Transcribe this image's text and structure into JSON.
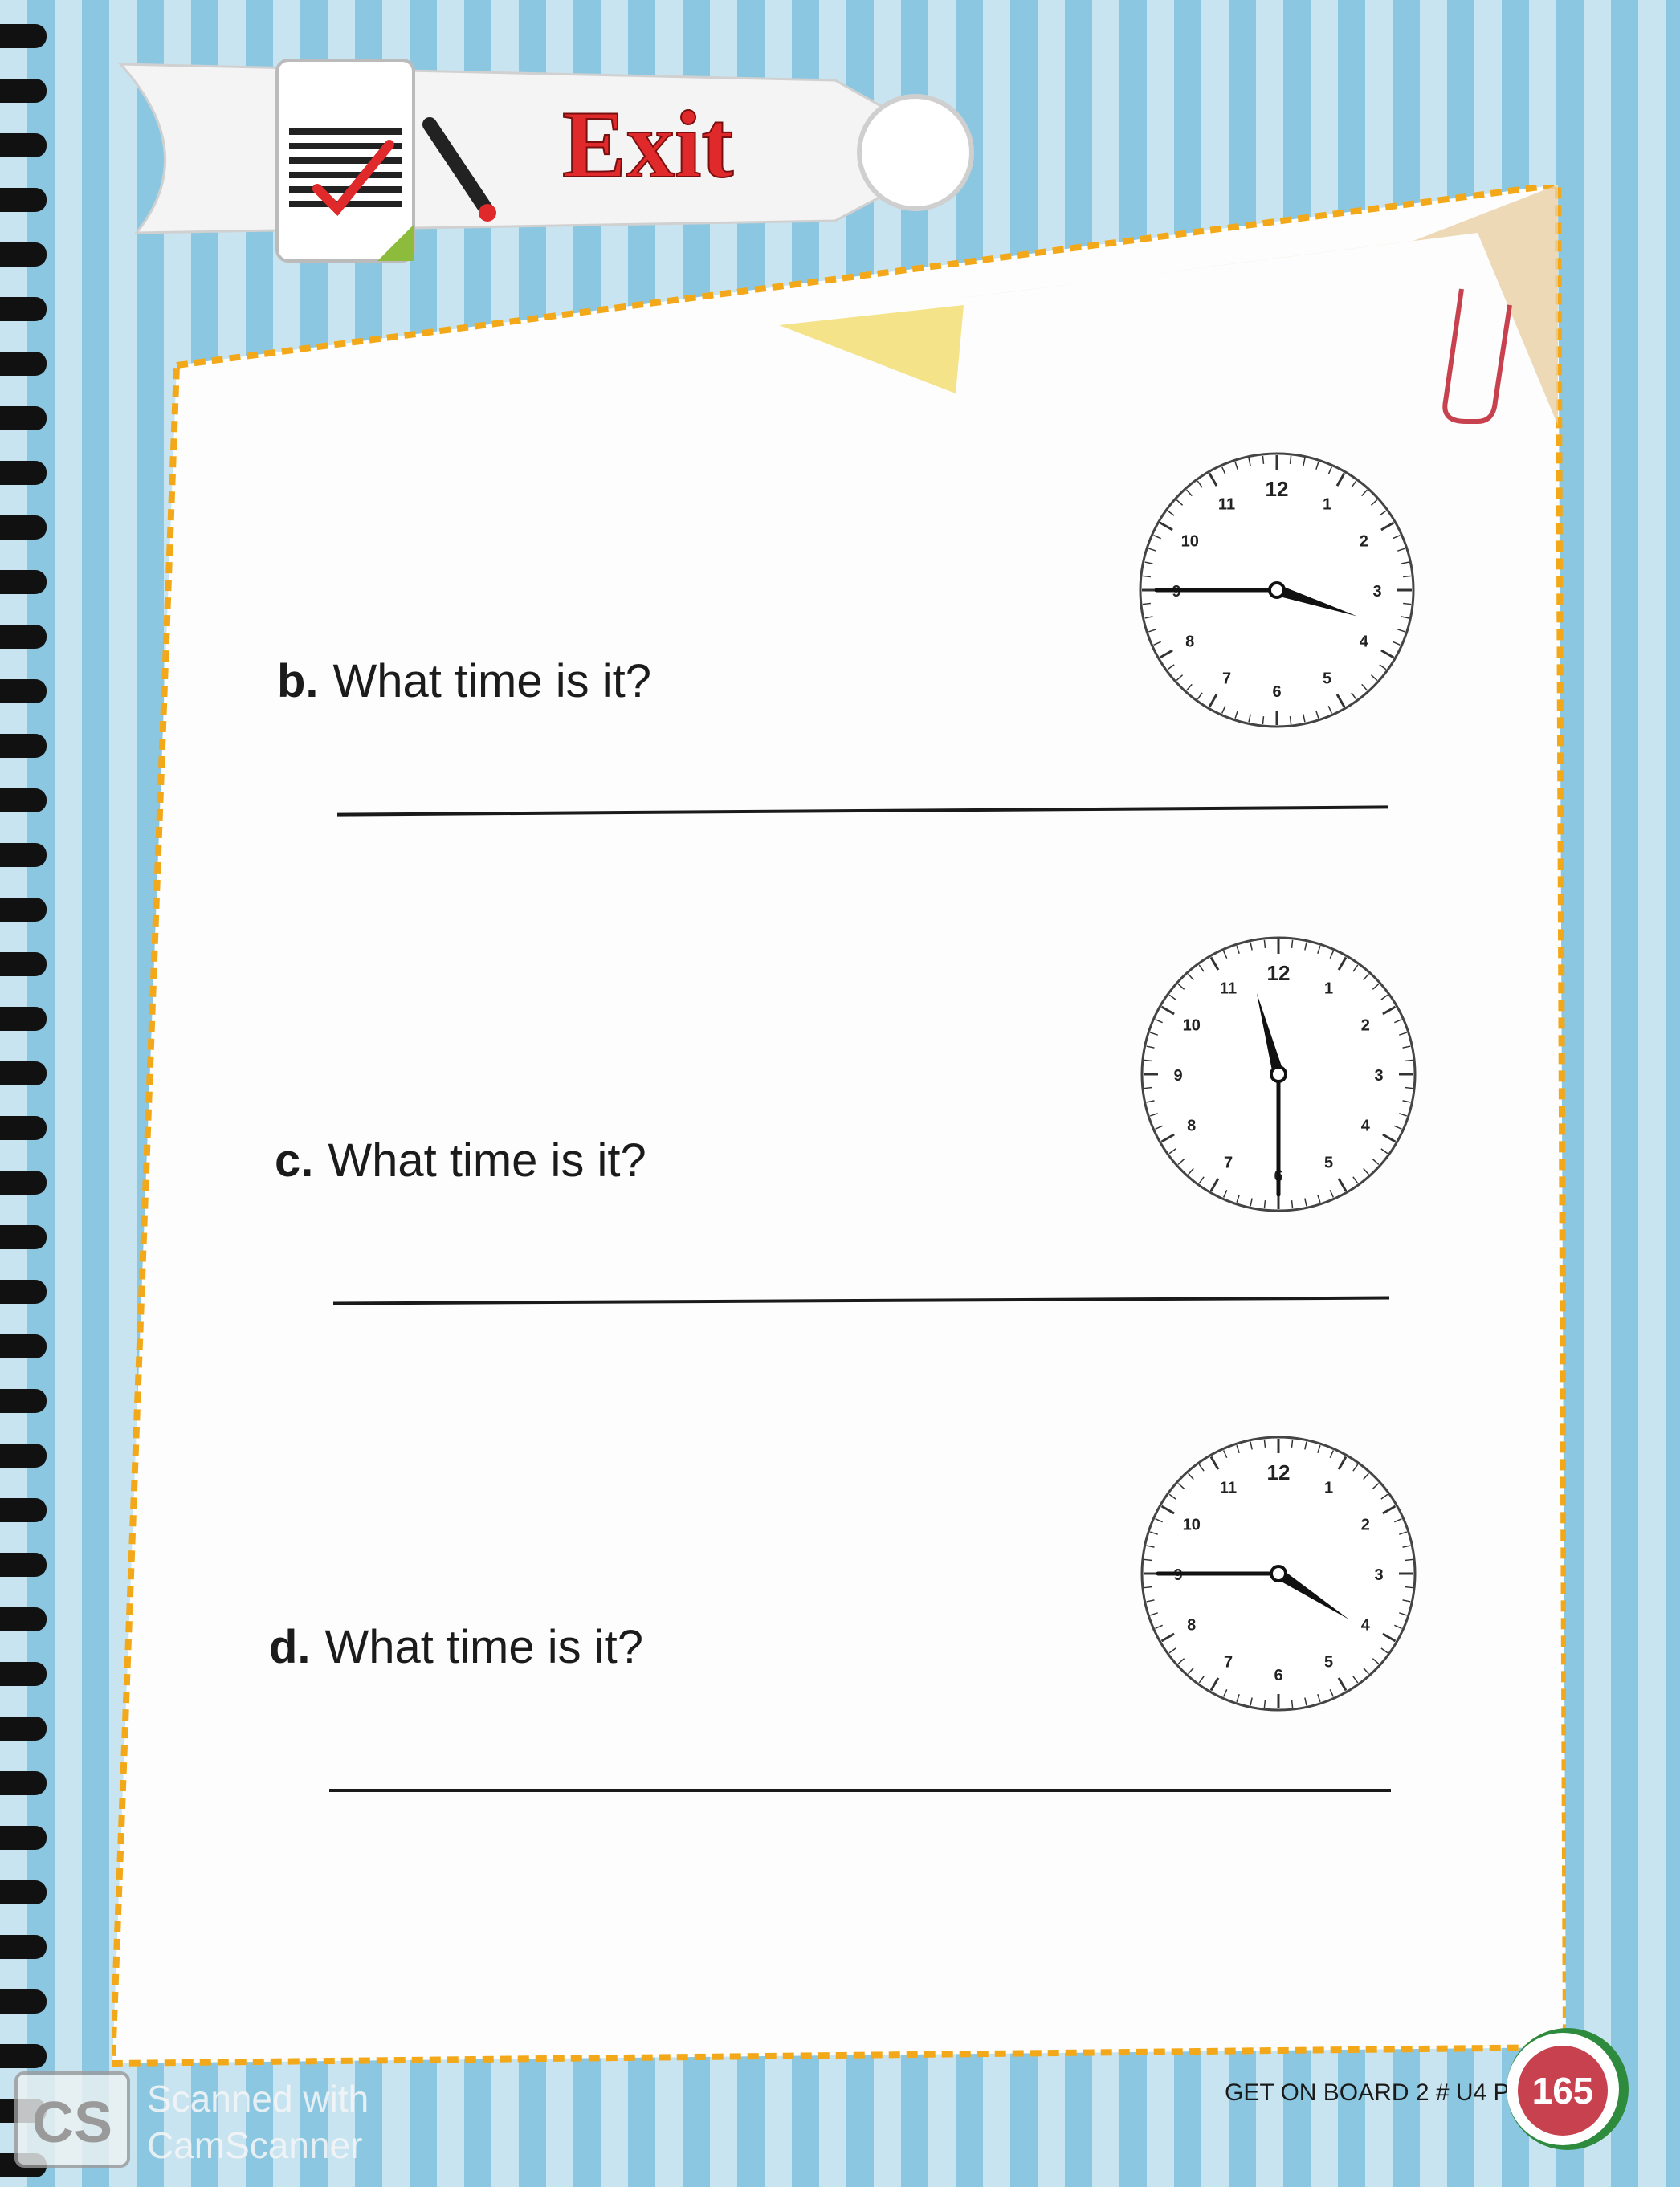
{
  "header": {
    "title": "Exit",
    "icon": "checklist-icon",
    "pencil_icon": "pencil-icon",
    "clip_icon": "paperclip-icon"
  },
  "colors": {
    "title_red": "#e0292a",
    "stripe_light": "#c9e4f1",
    "stripe_dark": "#8cc7e2",
    "paper_border": "#f2a818",
    "badge": "#c8414e"
  },
  "questions": [
    {
      "letter": "b.",
      "text": "What time is it?",
      "clock": {
        "hour_hand": 3.6,
        "minute_hand": 45
      }
    },
    {
      "letter": "c.",
      "text": "What time is it?",
      "clock": {
        "hour_hand": 11.5,
        "minute_hand": 30
      }
    },
    {
      "letter": "d.",
      "text": "What time is it?",
      "clock": {
        "hour_hand": 4.1,
        "minute_hand": 45
      }
    }
  ],
  "clock_numerals": [
    "12",
    "1",
    "2",
    "3",
    "4",
    "5",
    "6",
    "7",
    "8",
    "9",
    "10",
    "11"
  ],
  "footer": {
    "book": "GET ON BOARD 2 # U4 PA",
    "page_number": "165"
  },
  "watermark": {
    "logo": "CS",
    "line1": "Scanned with",
    "line2": "CamScanner"
  }
}
